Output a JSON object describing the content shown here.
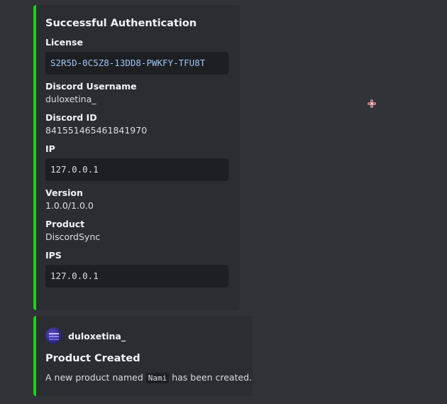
{
  "auth_embed": {
    "title": "Successful Authentication",
    "fields": [
      {
        "name": "License",
        "value": "S2R5D-0C5Z8-13DD8-PWKFY-TFU8T"
      },
      {
        "name": "Discord Username",
        "value": "duloxetina_"
      },
      {
        "name": "Discord ID",
        "value": "841551465461841970"
      },
      {
        "name": "IP",
        "value": "127.0.0.1"
      },
      {
        "name": "Version",
        "value": "1.0.0/1.0.0"
      },
      {
        "name": "Product",
        "value": "DiscordSync"
      },
      {
        "name": "IPS",
        "value": "127.0.0.1"
      }
    ]
  },
  "product_embed": {
    "author_name": "duloxetina_",
    "title": "Product Created",
    "description_before": "A new product named ",
    "product_name": "Nami",
    "description_after": " has been created."
  },
  "colors": {
    "background": "#313338",
    "embed_background": "#2b2d31",
    "embed_accent": "#1bd21b",
    "code_background": "#1e1f22",
    "license_code_text": "#9cc6f5"
  },
  "icons": {
    "cursor": "crosshair-cursor-icon",
    "avatar": "user-avatar"
  }
}
